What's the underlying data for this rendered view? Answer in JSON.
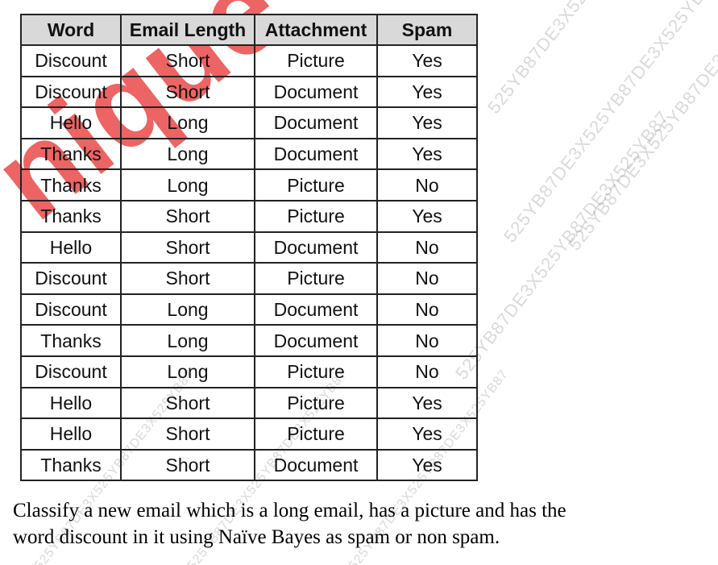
{
  "table": {
    "headers": [
      "Word",
      "Email Length",
      "Attachment",
      "Spam"
    ],
    "rows": [
      [
        "Discount",
        "Short",
        "Picture",
        "Yes"
      ],
      [
        "Discount",
        "Short",
        "Document",
        "Yes"
      ],
      [
        "Hello",
        "Long",
        "Document",
        "Yes"
      ],
      [
        "Thanks",
        "Long",
        "Document",
        "Yes"
      ],
      [
        "Thanks",
        "Long",
        "Picture",
        "No"
      ],
      [
        "Thanks",
        "Short",
        "Picture",
        "Yes"
      ],
      [
        "Hello",
        "Short",
        "Document",
        "No"
      ],
      [
        "Discount",
        "Short",
        "Picture",
        "No"
      ],
      [
        "Discount",
        "Long",
        "Document",
        "No"
      ],
      [
        "Thanks",
        "Long",
        "Document",
        "No"
      ],
      [
        "Discount",
        "Long",
        "Picture",
        "No"
      ],
      [
        "Hello",
        "Short",
        "Picture",
        "Yes"
      ],
      [
        "Hello",
        "Short",
        "Picture",
        "Yes"
      ],
      [
        "Thanks",
        "Short",
        "Document",
        "Yes"
      ]
    ]
  },
  "question": {
    "line1": "Classify a new email which is a long email, has a picture and has the",
    "line2": "word discount in it using Naïve Bayes as spam or non spam."
  },
  "watermark": {
    "large_text": "nique",
    "repeat_text": "525YB87DE3X525YB87DE3X525YB87",
    "accent_color": "#e62828"
  }
}
